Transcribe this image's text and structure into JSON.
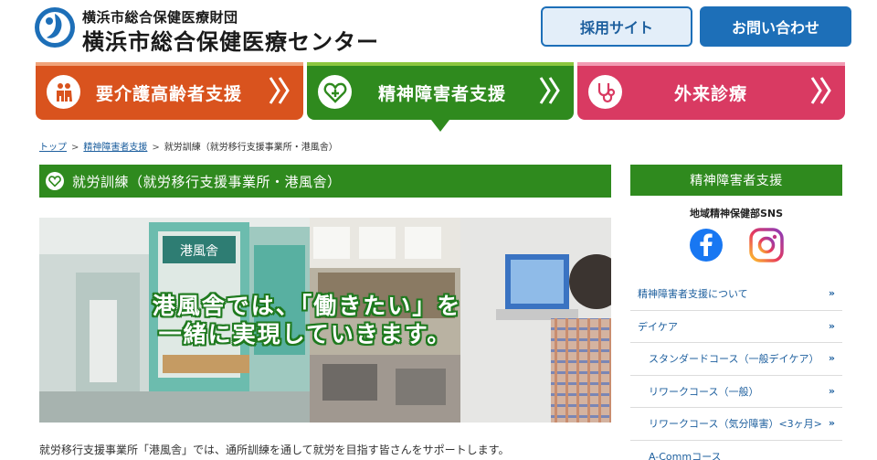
{
  "header": {
    "org_small": "横浜市総合保健医療財団",
    "org_big": "横浜市総合保健医療センター",
    "recruit_label": "採用サイト",
    "contact_label": "お問い合わせ"
  },
  "tabs": [
    {
      "label": "要介護高齢者支援",
      "icon": "elderly-couple-icon",
      "color": "#d9531e"
    },
    {
      "label": "精神障害者支援",
      "icon": "heart-plus-icon",
      "color": "#2f8a1e"
    },
    {
      "label": "外来診療",
      "icon": "stethoscope-icon",
      "color": "#d93a62"
    }
  ],
  "breadcrumb": {
    "items": [
      "トップ",
      "精神障害者支援"
    ],
    "current": "就労訓練（就労移行支援事業所・港風舎）"
  },
  "page": {
    "title": "就労訓練（就労移行支援事業所・港風舎）",
    "hero_line1": "港風舎では、「働きたい」を",
    "hero_line2": "一緒に実現していきます。",
    "hero_sign": "港風舎",
    "intro": "就労移行支援事業所「港風舎」では、通所訓練を通して就労を目指す皆さんをサポートします。"
  },
  "sidebar": {
    "heading": "精神障害者支援",
    "sns_title": "地域精神保健部SNS",
    "items": [
      {
        "label": "精神障害者支援について",
        "sub": false
      },
      {
        "label": "デイケア",
        "sub": false
      },
      {
        "label": "スタンダードコース（一般デイケア）",
        "sub": true
      },
      {
        "label": "リワークコース（一般）",
        "sub": true
      },
      {
        "label": "リワークコース（気分障害）<3ヶ月>",
        "sub": true
      },
      {
        "label": "A-Commコース",
        "sub": true
      }
    ],
    "chevron": "»"
  },
  "colors": {
    "brand_blue": "#1d6fb8",
    "green": "#2f8a1e",
    "orange": "#d9531e",
    "pink": "#d93a62"
  }
}
